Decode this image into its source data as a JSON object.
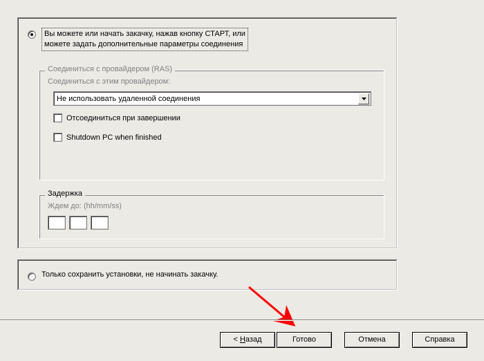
{
  "main": {
    "radio1_line1": "Вы можете или начать закачку, нажав кнопку СТАРТ, или",
    "radio1_line2": "можете задать дополнительные параметры соединения",
    "ras_group_title": "Соединиться с провайдером (RAS)",
    "ras_provider_label": "Соединиться с этим провайдером:",
    "ras_dropdown_value": "Не использовать удаленной соединения",
    "ras_disconnect_label": "Отсоединиться при завершении",
    "ras_shutdown_label": "Shutdown PC when finished",
    "delay_group_title": "Задержка",
    "delay_wait_label": "Ждем до: (hh/mm/ss)"
  },
  "second": {
    "radio2_label": "Только сохранить установки, не начинать закачку."
  },
  "buttons": {
    "back_prefix": "< ",
    "back_u": "Н",
    "back_rest": "азад",
    "finish": "Готово",
    "cancel": "Отмена",
    "help": "Справка"
  }
}
